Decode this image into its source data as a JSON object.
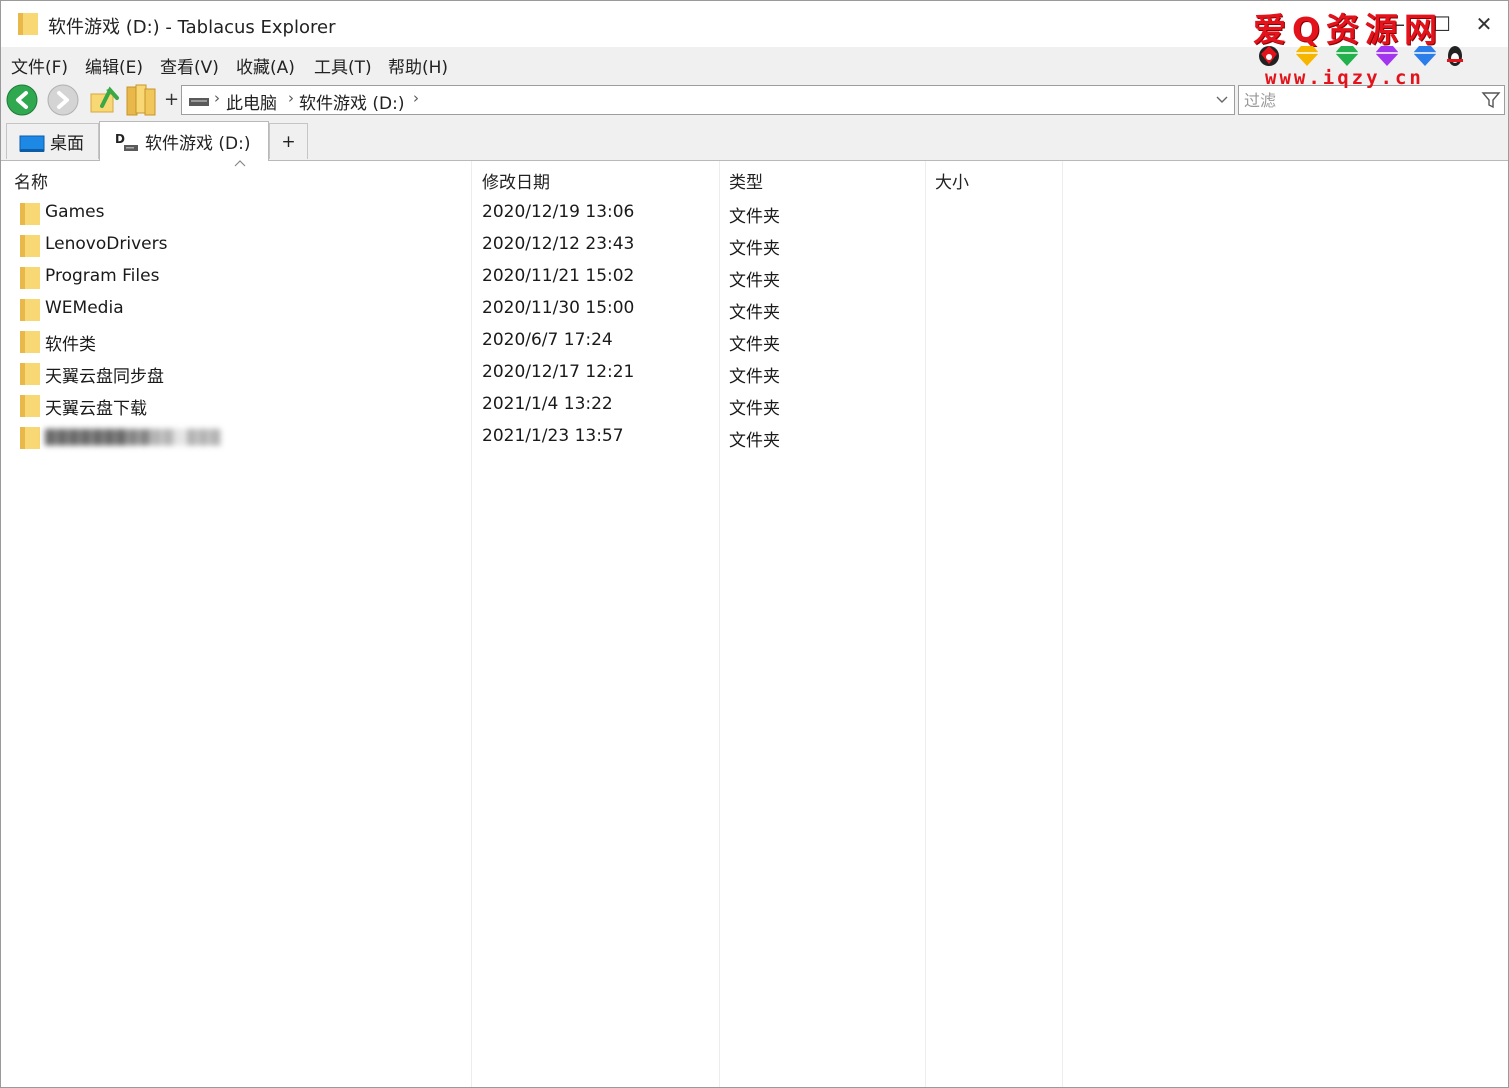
{
  "window": {
    "title": "软件游戏 (D:) - Tablacus Explorer"
  },
  "watermark": {
    "title": "爱Q资源网",
    "url": "www.iqzy.cn"
  },
  "menu": [
    "文件(F)",
    "编辑(E)",
    "查看(V)",
    "收藏(A)",
    "工具(T)",
    "帮助(H)"
  ],
  "toolbar": {
    "add_label": "+"
  },
  "address": {
    "crumbs": [
      "此电脑",
      "软件游戏 (D:)"
    ]
  },
  "filter": {
    "placeholder": "过滤",
    "value": ""
  },
  "tabs": [
    {
      "label": "桌面",
      "active": false
    },
    {
      "label": "软件游戏 (D:)",
      "active": true
    }
  ],
  "new_tab_label": "+",
  "columns": [
    "名称",
    "修改日期",
    "类型",
    "大小"
  ],
  "files": [
    {
      "name": "Games",
      "date": "2020/12/19 13:06",
      "type": "文件夹"
    },
    {
      "name": "LenovoDrivers",
      "date": "2020/12/12 23:43",
      "type": "文件夹"
    },
    {
      "name": "Program Files",
      "date": "2020/11/21 15:02",
      "type": "文件夹"
    },
    {
      "name": "WEMedia",
      "date": "2020/11/30 15:00",
      "type": "文件夹"
    },
    {
      "name": "软件类",
      "date": "2020/6/7 17:24",
      "type": "文件夹"
    },
    {
      "name": "天翼云盘同步盘",
      "date": "2020/12/17 12:21",
      "type": "文件夹"
    },
    {
      "name": "天翼云盘下载",
      "date": "2021/1/4 13:22",
      "type": "文件夹"
    },
    {
      "name": "",
      "date": "2021/1/23 13:57",
      "type": "文件夹",
      "blurred": true
    }
  ],
  "colors": {
    "folder": "#f8d775",
    "folder_dark": "#e8b84a",
    "watermark": "#e3121b",
    "menu_bg": "#f0f0f0",
    "nav_back": "#2fa84f"
  }
}
